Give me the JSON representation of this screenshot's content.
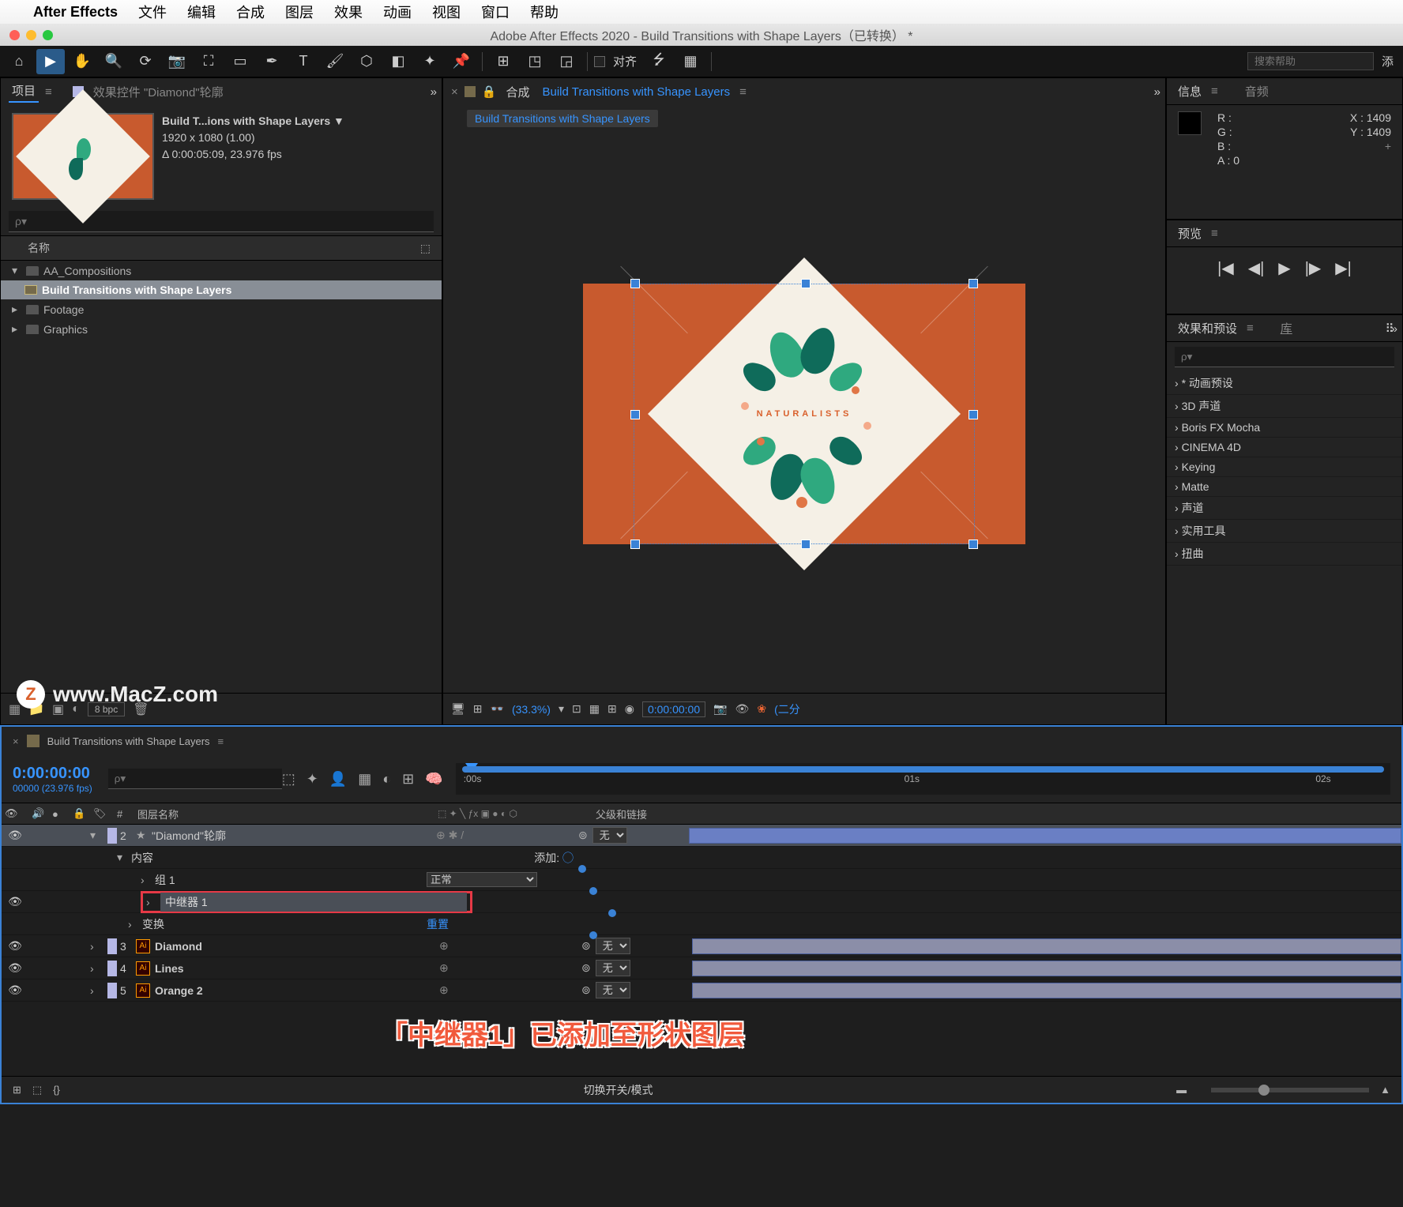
{
  "mac_menu": {
    "app": "After Effects",
    "items": [
      "文件",
      "编辑",
      "合成",
      "图层",
      "效果",
      "动画",
      "视图",
      "窗口",
      "帮助"
    ]
  },
  "window": {
    "title": "Adobe After Effects 2020 - Build Transitions with Shape Layers（已转换） *"
  },
  "toolbar": {
    "align_label": "对齐",
    "search_placeholder": "搜索帮助",
    "add_label": "添"
  },
  "project": {
    "panel_title": "项目",
    "effect_controls_tab": "效果控件 \"Diamond\"轮廓",
    "comp_name": "Build T...ions with Shape Layers ▼",
    "comp_dims": "1920 x 1080 (1.00)",
    "comp_dur": "Δ 0:00:05:09, 23.976 fps",
    "search_placeholder": "ρ▾",
    "col_name": "名称",
    "items": [
      {
        "type": "folder",
        "label": "AA_Compositions",
        "expanded": true
      },
      {
        "type": "comp",
        "label": "Build Transitions with Shape Layers",
        "selected": true,
        "indent": true
      },
      {
        "type": "folder",
        "label": "Footage",
        "expanded": false
      },
      {
        "type": "folder",
        "label": "Graphics",
        "expanded": false
      }
    ],
    "watermark": "www.MacZ.com",
    "bpc": "8 bpc"
  },
  "composition": {
    "panel_prefix": "合成",
    "comp_name": "Build Transitions with Shape Layers",
    "flowchart_chip": "Build Transitions with Shape Layers",
    "canvas_text": "NATURALISTS",
    "zoom": "(33.3%)",
    "timecode": "0:00:00:00",
    "quality": "(二分"
  },
  "info": {
    "tab": "信息",
    "audio_tab": "音频",
    "r": "R :",
    "g": "G :",
    "b": "B :",
    "a": "A : 0",
    "x": "X : 1409",
    "y": "Y : 1409"
  },
  "preview": {
    "tab": "预览"
  },
  "effects": {
    "tab": "效果和预设",
    "lib_tab": "库",
    "search_placeholder": "ρ▾",
    "categories": [
      "* 动画预设",
      "3D 声道",
      "Boris FX Mocha",
      "CINEMA 4D",
      "Keying",
      "Matte",
      "声道",
      "实用工具",
      "扭曲"
    ]
  },
  "timeline": {
    "comp_name": "Build Transitions with Shape Layers",
    "timecode": "0:00:00:00",
    "timecode_sub": "00000 (23.976 fps)",
    "search_placeholder": "ρ▾",
    "ruler_marks": [
      ":00s",
      "01s",
      "02s"
    ],
    "col_layer_name": "图层名称",
    "col_parent": "父级和链接",
    "footer_label": "切换开关/模式",
    "add_label": "添加:",
    "layers": [
      {
        "num": "2",
        "name": "\"Diamond\"轮廓",
        "selected": true,
        "parent": "无",
        "star": true
      },
      {
        "sub": true,
        "name": "内容",
        "expanded": true
      },
      {
        "sub": true,
        "name": "组 1",
        "mode": "正常",
        "indent": 2
      },
      {
        "sub": true,
        "name": "中继器 1",
        "highlight": true,
        "indent": 2
      },
      {
        "sub": true,
        "name": "变换",
        "link": "重置",
        "indent": 1
      },
      {
        "num": "3",
        "name": "Diamond",
        "parent": "无",
        "ai": true
      },
      {
        "num": "4",
        "name": "Lines",
        "parent": "无",
        "ai": true
      },
      {
        "num": "5",
        "name": "Orange 2",
        "parent": "无",
        "ai": true
      }
    ]
  },
  "annotation": "「中继器1」已添加至形状图层"
}
